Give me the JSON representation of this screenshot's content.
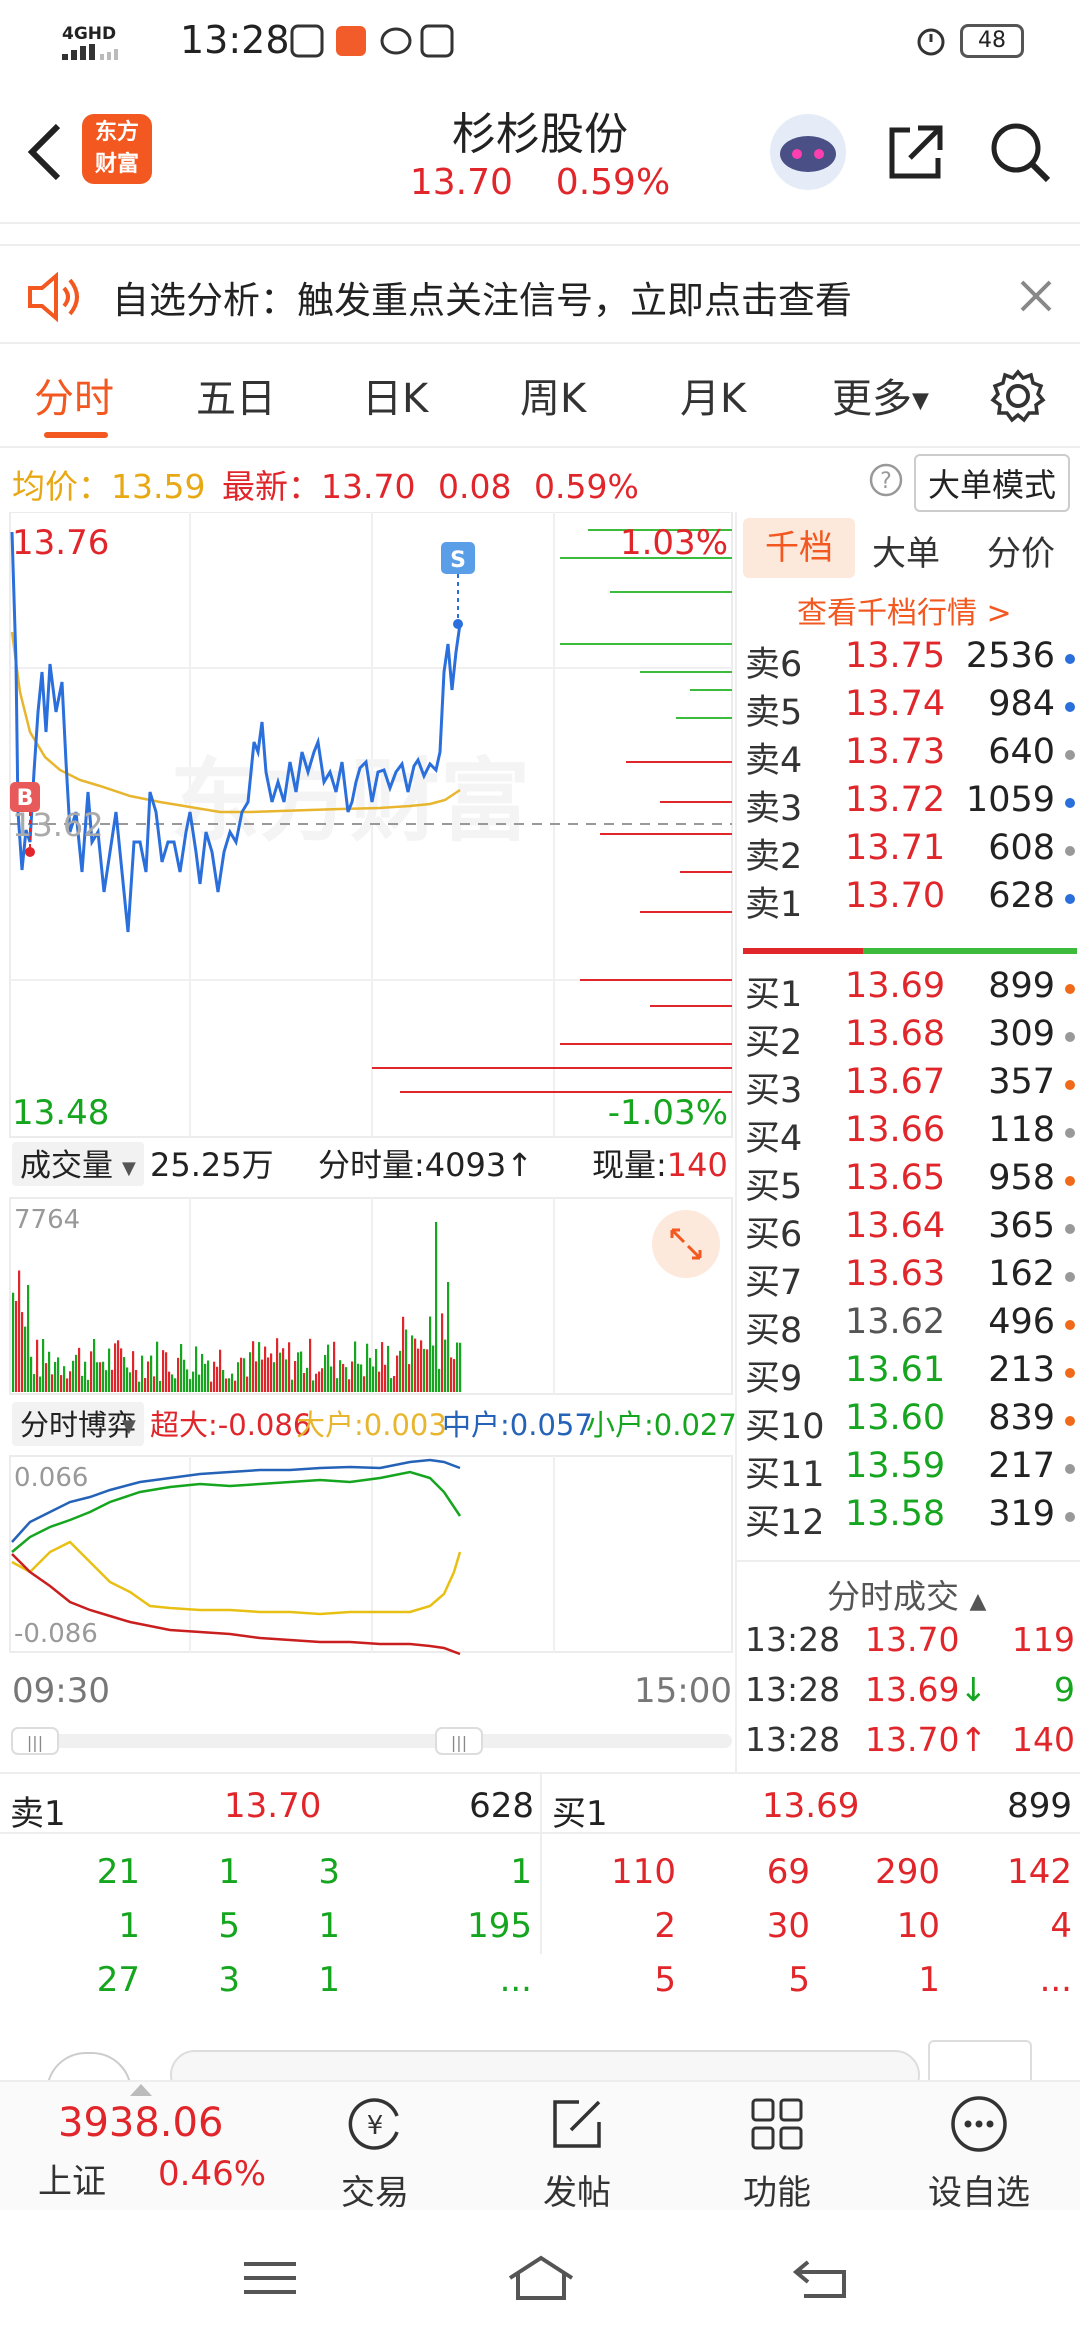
{
  "status_bar": {
    "network": "4GHD",
    "time": "13:28",
    "battery": "48"
  },
  "header": {
    "logo_text_1": "东方",
    "logo_text_2": "财富",
    "stock_name": "杉杉股份",
    "price": "13.70",
    "change_pct": "0.59%"
  },
  "banner": {
    "text": "自选分析：触发重点关注信号，立即点击查看"
  },
  "tabs": [
    {
      "label": "分时",
      "active": true
    },
    {
      "label": "五日",
      "active": false
    },
    {
      "label": "日K",
      "active": false
    },
    {
      "label": "周K",
      "active": false
    },
    {
      "label": "月K",
      "active": false
    },
    {
      "label": "更多",
      "active": false
    }
  ],
  "info_line": {
    "avg_label": "均价：",
    "avg_value": "13.59",
    "latest_label": "最新：",
    "latest_value": "13.70",
    "change": "0.08",
    "change_pct": "0.59%",
    "mode_button": "大单模式"
  },
  "price_chart": {
    "high": "13.76",
    "low": "13.48",
    "high_pct": "1.03%",
    "low_pct": "-1.03%",
    "prev_close": "13.62",
    "watermark": "东方财富",
    "buy_marker": "B",
    "sell_marker": "S"
  },
  "volume_bar": {
    "selector": "成交量",
    "total": "25.25万",
    "minute_label": "分时量:",
    "minute_value": "4093",
    "current_label": "现量:",
    "current_value": "140",
    "max_tick": "7764"
  },
  "fund_bar": {
    "selector": "分时博弈",
    "super_label": "超大:",
    "super_value": "-0.086",
    "large_label": "大户:",
    "large_value": "0.003",
    "mid_label": "中户:",
    "mid_value": "0.057",
    "small_label": "小户:",
    "small_value": "0.027",
    "top_tick": "0.066",
    "bottom_tick": "-0.086"
  },
  "time_axis": {
    "start": "09:30",
    "end": "15:00"
  },
  "orderbook": {
    "tabs": [
      "千档",
      "大单",
      "分价"
    ],
    "link": "查看千档行情 >",
    "asks": [
      {
        "label": "卖6",
        "price": "13.75",
        "vol": "2536",
        "dot": "#2a6fdb"
      },
      {
        "label": "卖5",
        "price": "13.74",
        "vol": "984",
        "dot": "#2a6fdb"
      },
      {
        "label": "卖4",
        "price": "13.73",
        "vol": "640",
        "dot": "#999999"
      },
      {
        "label": "卖3",
        "price": "13.72",
        "vol": "1059",
        "dot": "#2a6fdb"
      },
      {
        "label": "卖2",
        "price": "13.71",
        "vol": "608",
        "dot": "#999999"
      },
      {
        "label": "卖1",
        "price": "13.70",
        "vol": "628",
        "dot": "#2a6fdb"
      }
    ],
    "bids": [
      {
        "label": "买1",
        "price": "13.69",
        "vol": "899",
        "dot": "#f06a1a",
        "color": "red"
      },
      {
        "label": "买2",
        "price": "13.68",
        "vol": "309",
        "dot": "#999999",
        "color": "red"
      },
      {
        "label": "买3",
        "price": "13.67",
        "vol": "357",
        "dot": "#f06a1a",
        "color": "red"
      },
      {
        "label": "买4",
        "price": "13.66",
        "vol": "118",
        "dot": "#999999",
        "color": "red"
      },
      {
        "label": "买5",
        "price": "13.65",
        "vol": "958",
        "dot": "#f06a1a",
        "color": "red"
      },
      {
        "label": "买6",
        "price": "13.64",
        "vol": "365",
        "dot": "#999999",
        "color": "red"
      },
      {
        "label": "买7",
        "price": "13.63",
        "vol": "162",
        "dot": "#999999",
        "color": "red"
      },
      {
        "label": "买8",
        "price": "13.62",
        "vol": "496",
        "dot": "#f06a1a",
        "color": "gray"
      },
      {
        "label": "买9",
        "price": "13.61",
        "vol": "213",
        "dot": "#f06a1a",
        "color": "green"
      },
      {
        "label": "买10",
        "price": "13.60",
        "vol": "839",
        "dot": "#f06a1a",
        "color": "green"
      },
      {
        "label": "买11",
        "price": "13.59",
        "vol": "217",
        "dot": "#999999",
        "color": "green"
      },
      {
        "label": "买12",
        "price": "13.58",
        "vol": "319",
        "dot": "#999999",
        "color": "green"
      }
    ],
    "trades_title": "分时成交",
    "trades": [
      {
        "time": "13:28",
        "price": "13.70",
        "arrow": "",
        "vol": "119",
        "pcolor": "red",
        "vcolor": "red"
      },
      {
        "time": "13:28",
        "price": "13.69",
        "arrow": "↓",
        "vol": "9",
        "pcolor": "red",
        "vcolor": "green"
      },
      {
        "time": "13:28",
        "price": "13.70",
        "arrow": "↑",
        "vol": "140",
        "pcolor": "red",
        "vcolor": "red"
      }
    ]
  },
  "queue": {
    "sell_label": "卖1",
    "sell_price": "13.70",
    "sell_vol": "628",
    "buy_label": "买1",
    "buy_price": "13.69",
    "buy_vol": "899",
    "sell_rows": [
      [
        "21",
        "1",
        "3",
        "1"
      ],
      [
        "1",
        "5",
        "1",
        "195"
      ],
      [
        "27",
        "3",
        "1",
        "..."
      ]
    ],
    "buy_rows": [
      [
        "110",
        "69",
        "290",
        "142"
      ],
      [
        "2",
        "30",
        "10",
        "4"
      ],
      [
        "5",
        "5",
        "1",
        "..."
      ]
    ]
  },
  "bottom_nav": {
    "index_value": "3938.06",
    "index_name": "上证",
    "index_pct": "0.46%",
    "items": [
      "交易",
      "发帖",
      "功能",
      "设自选"
    ]
  }
}
